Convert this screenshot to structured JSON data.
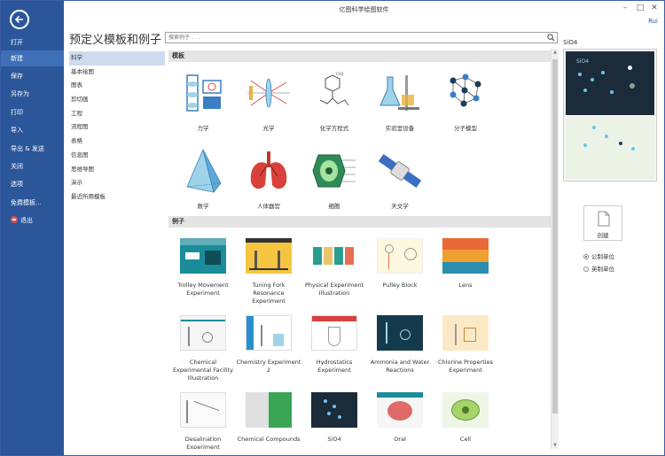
{
  "app": {
    "title": "亿图科学绘图软件",
    "user": "Rui"
  },
  "sidebar": {
    "items": [
      {
        "label": "打开"
      },
      {
        "label": "新建"
      },
      {
        "label": "保存"
      },
      {
        "label": "另存为"
      },
      {
        "label": "打印"
      },
      {
        "label": "导入"
      },
      {
        "label": "导出 & 发送"
      },
      {
        "label": "关闭"
      },
      {
        "label": "选项"
      },
      {
        "label": "免费模板..."
      },
      {
        "label": "退出"
      }
    ]
  },
  "page": {
    "title": "预定义模板和例子"
  },
  "search": {
    "placeholder": "搜索例子 . . ."
  },
  "categories": [
    "科学",
    "基本绘图",
    "图表",
    "剪切画",
    "工程",
    "流程图",
    "表格",
    "信息图",
    "思维导图",
    "演示",
    "最近所用模板"
  ],
  "templates": {
    "header": "模板",
    "items": [
      "力学",
      "光学",
      "化学方程式",
      "实验室设备",
      "分子模型",
      "数学",
      "人体器官",
      "细胞",
      "天文学"
    ]
  },
  "examples": {
    "header": "例子",
    "items": [
      "Trolley Movement Experiment",
      "Tuning Fork Resonance Experiment",
      "Physical Experiment Illustration",
      "Pulley Block",
      "Lens",
      "Chemical Experimental Facility Illustration",
      "Chemistry Experiment 2",
      "Hydrostatics Experiment",
      "Ammonia and Water Reactions",
      "Chlorine Properties Experiment",
      "Desalination Experiment",
      "Chemical Compounds",
      "SiO4",
      "Oral",
      "Cell"
    ]
  },
  "preview": {
    "title": "SiO4",
    "thumb_text": "SiO4"
  },
  "create": {
    "label": "创建"
  },
  "units": {
    "metric": "公制单位",
    "imperial": "英制单位"
  },
  "colors": {
    "sidebar": "#2b579a",
    "accent": "#3e6fb7"
  }
}
